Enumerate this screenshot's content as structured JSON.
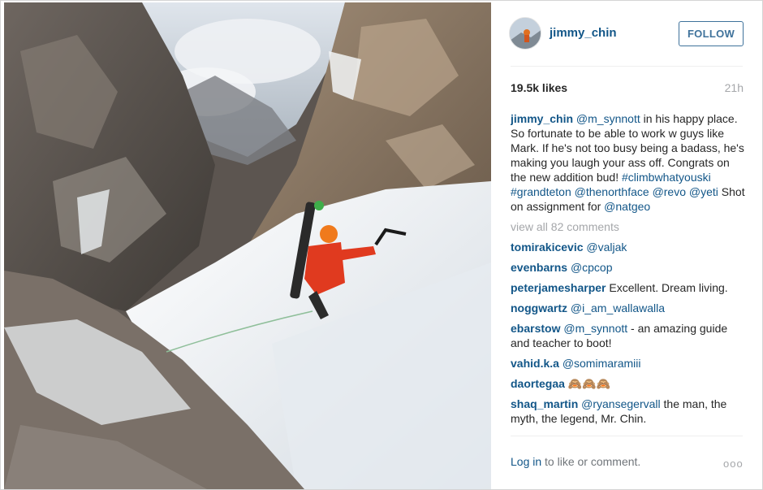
{
  "post": {
    "photo_alt": "",
    "author": {
      "username": "jimmy_chin"
    },
    "follow_label": "FOLLOW",
    "likes": "19.5k likes",
    "time_ago": "21h",
    "caption": {
      "username": "jimmy_chin",
      "m1": "@m_synnott",
      "t1": " in his happy place. So fortunate to be able to work w guys like Mark. If he's not too busy being a badass, he's making you laugh your ass off. Congrats on the new addition bud! ",
      "h1": "#climbwhatyouski",
      "t2": " ",
      "h2": "#grandteton",
      "t3": " ",
      "m2": "@thenorthface",
      "t4": " ",
      "m3": "@revo",
      "t5": " ",
      "m4": "@yeti",
      "t6": " Shot on assignment for ",
      "m5": "@natgeo"
    },
    "view_all": "view all 82 comments",
    "comments": [
      {
        "user": "tomirakicevic",
        "mention": "@valjak",
        "text": ""
      },
      {
        "user": "evenbarns",
        "mention": "@cpcop",
        "text": ""
      },
      {
        "user": "peterjamesharper",
        "mention": "",
        "text": " Excellent. Dream living."
      },
      {
        "user": "noggwartz",
        "mention": "@i_am_wallawalla",
        "text": ""
      },
      {
        "user": "ebarstow",
        "mention": "@m_synnott",
        "text": " - an amazing guide and teacher to boot!"
      },
      {
        "user": "vahid.k.a",
        "mention": "@somimaramiii",
        "text": ""
      },
      {
        "user": "daortegaa",
        "mention": "",
        "text": " 🙈🙈🙈"
      },
      {
        "user": "shaq_martin",
        "mention": "@ryansegervall",
        "text": " the man, the myth, the legend, Mr. Chin."
      }
    ],
    "footer": {
      "login_link": "Log in",
      "login_text": " to like or comment.",
      "more": "ooo"
    }
  },
  "colors": {
    "link": "#125688",
    "follow": "#3f729b",
    "muted": "#a5a7aa"
  }
}
